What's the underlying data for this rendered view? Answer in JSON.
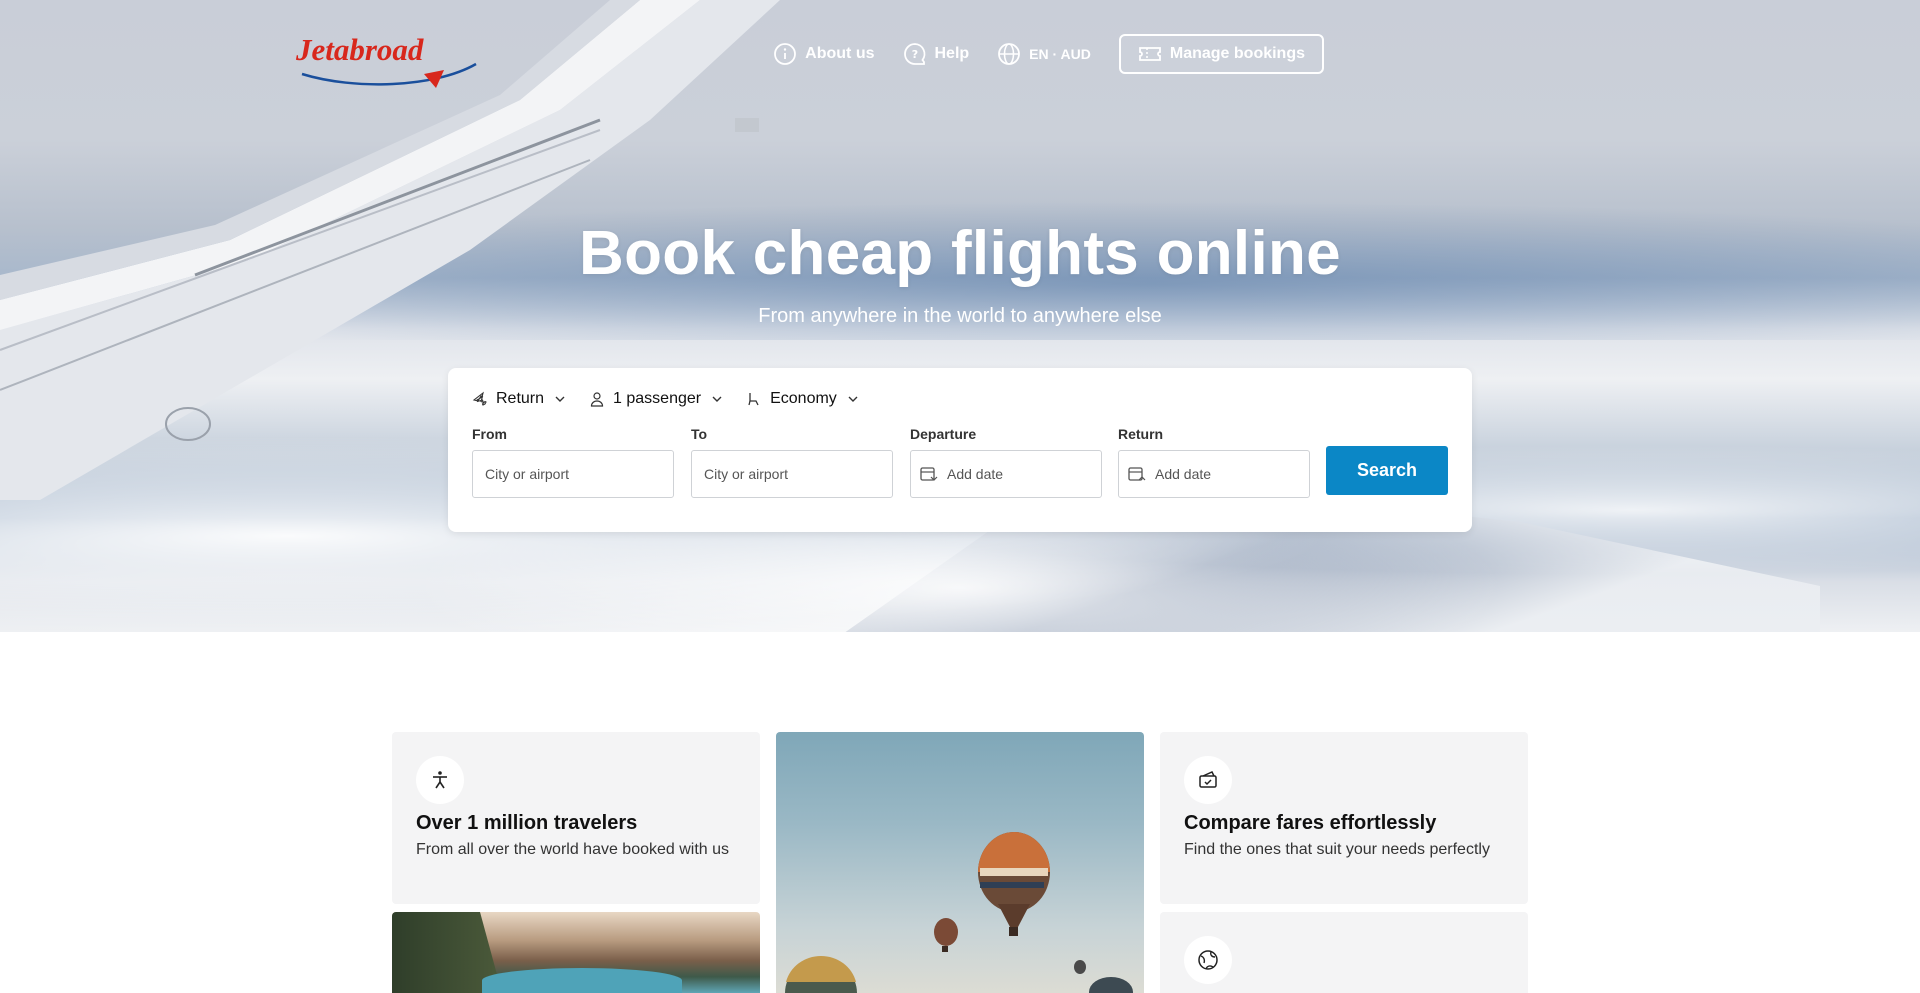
{
  "brand": {
    "name": "Jetabroad",
    "color": "#d8271c",
    "swoosh_color": "#1a4f9c"
  },
  "nav": {
    "about": "About us",
    "help": "Help",
    "lang": "EN · AUD",
    "manage": "Manage bookings"
  },
  "hero": {
    "title": "Book cheap flights online",
    "subtitle": "From anywhere in the world to anywhere else"
  },
  "search": {
    "trip_type": "Return",
    "passengers": "1 passenger",
    "cabin": "Economy",
    "from": {
      "label": "From",
      "placeholder": "City or airport"
    },
    "to": {
      "label": "To",
      "placeholder": "City or airport"
    },
    "departure": {
      "label": "Departure",
      "placeholder": "Add date"
    },
    "return": {
      "label": "Return",
      "placeholder": "Add date"
    },
    "button": "Search",
    "accent": "#0b87c6"
  },
  "features": [
    {
      "icon": "accessibility-person-icon",
      "title": "Over 1 million travelers",
      "desc": "From all over the world have booked with us"
    },
    {
      "icon": "ticket-compare-icon",
      "title": "Compare fares effortlessly",
      "desc": "Find the ones that suit your needs perfectly"
    },
    {
      "icon": "globe-icon",
      "title": "",
      "desc": ""
    }
  ]
}
